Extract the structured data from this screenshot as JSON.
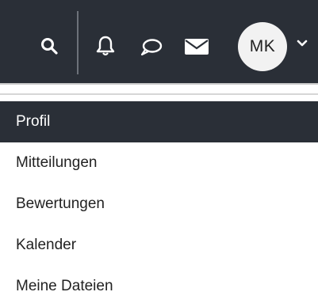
{
  "header": {
    "avatar_initials": "MK",
    "icons": [
      "search-icon",
      "bell-icon",
      "chat-bubble-icon",
      "mail-icon",
      "chevron-down-icon"
    ],
    "colors": {
      "topbar": "#2a2f37",
      "icon": "#ffffff",
      "avatar_bg": "#f2f2f2"
    }
  },
  "menu": {
    "items": [
      {
        "label": "Profil",
        "active": true
      },
      {
        "label": "Mitteilungen",
        "active": false
      },
      {
        "label": "Bewertungen",
        "active": false
      },
      {
        "label": "Kalender",
        "active": false
      },
      {
        "label": "Meine Dateien",
        "active": false
      }
    ],
    "colors": {
      "active_bg": "#2a2f37",
      "active_text": "#ffffff",
      "text": "#222222"
    }
  }
}
